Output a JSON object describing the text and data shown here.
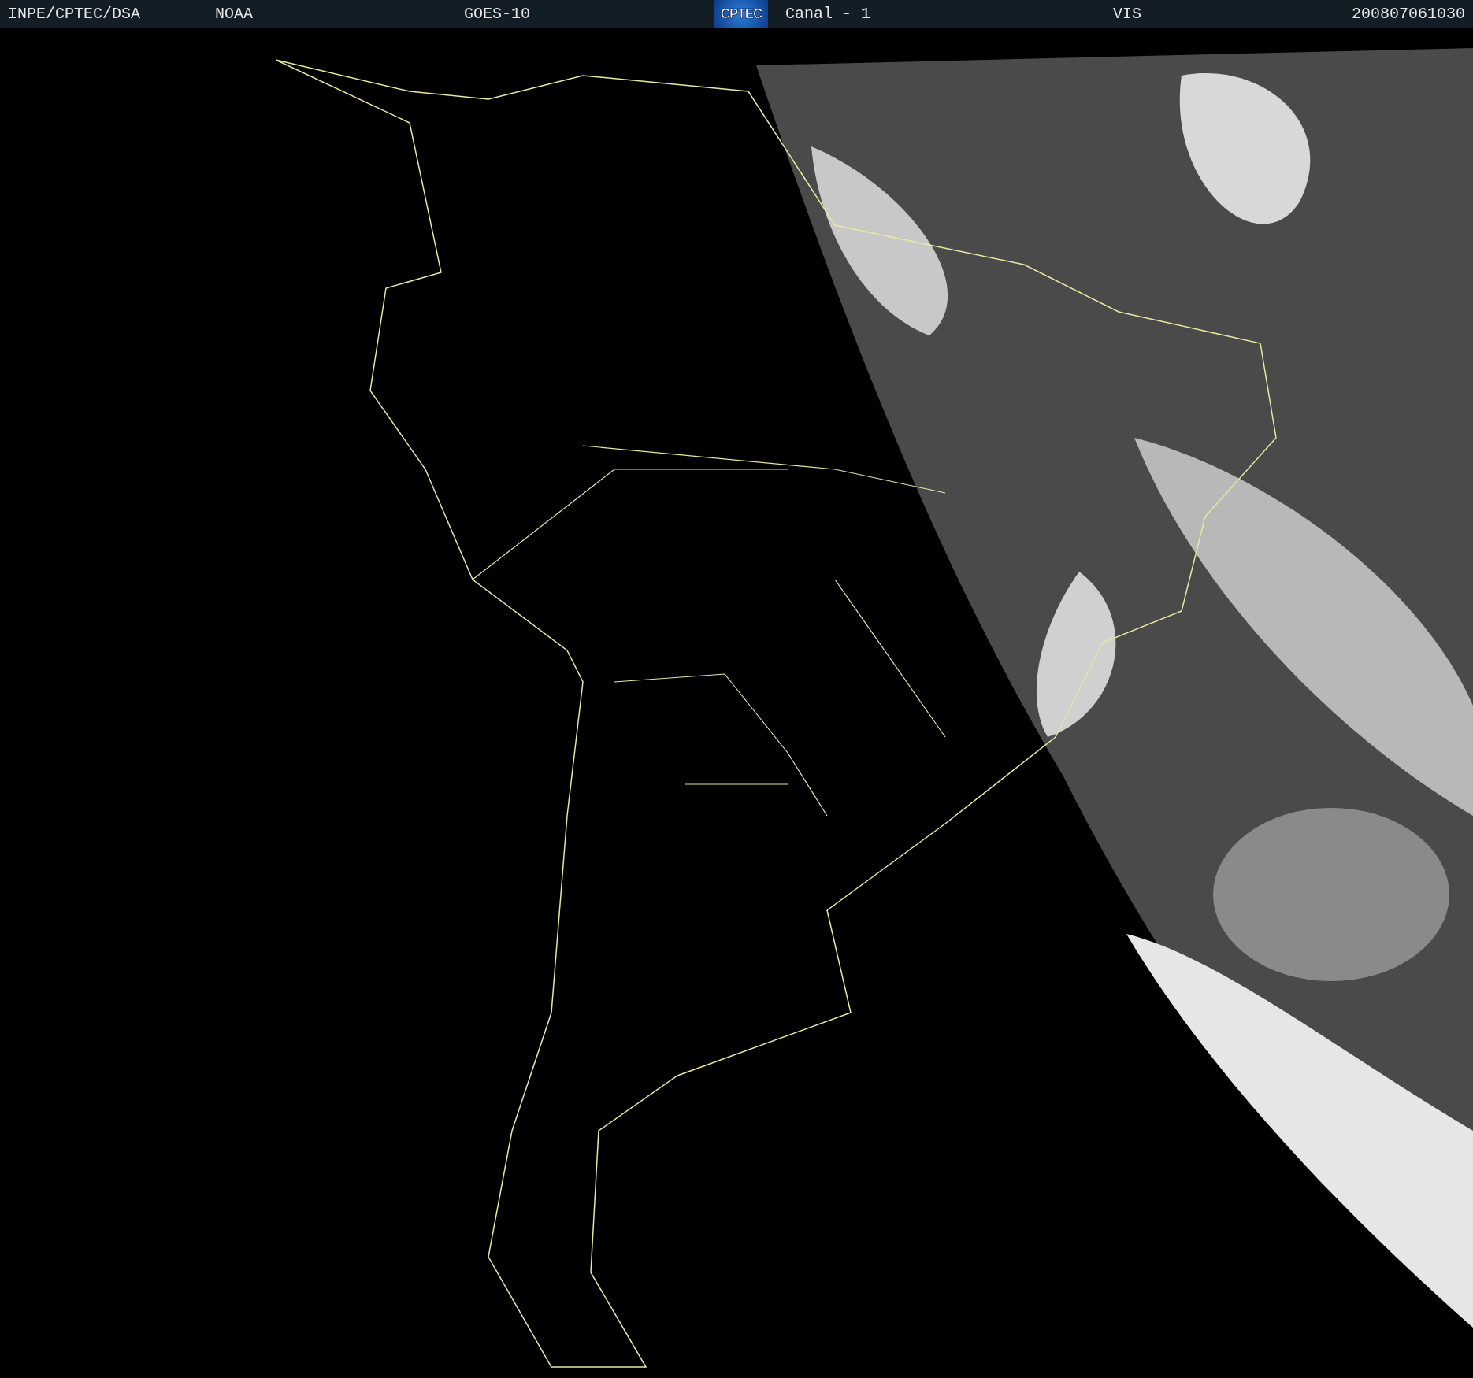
{
  "header": {
    "agency": "INPE/CPTEC/DSA",
    "operator": "NOAA",
    "satellite": "GOES-10",
    "logo": "CPTEC",
    "channel": "Canal - 1",
    "band": "VIS",
    "timestamp": "200807061030"
  }
}
